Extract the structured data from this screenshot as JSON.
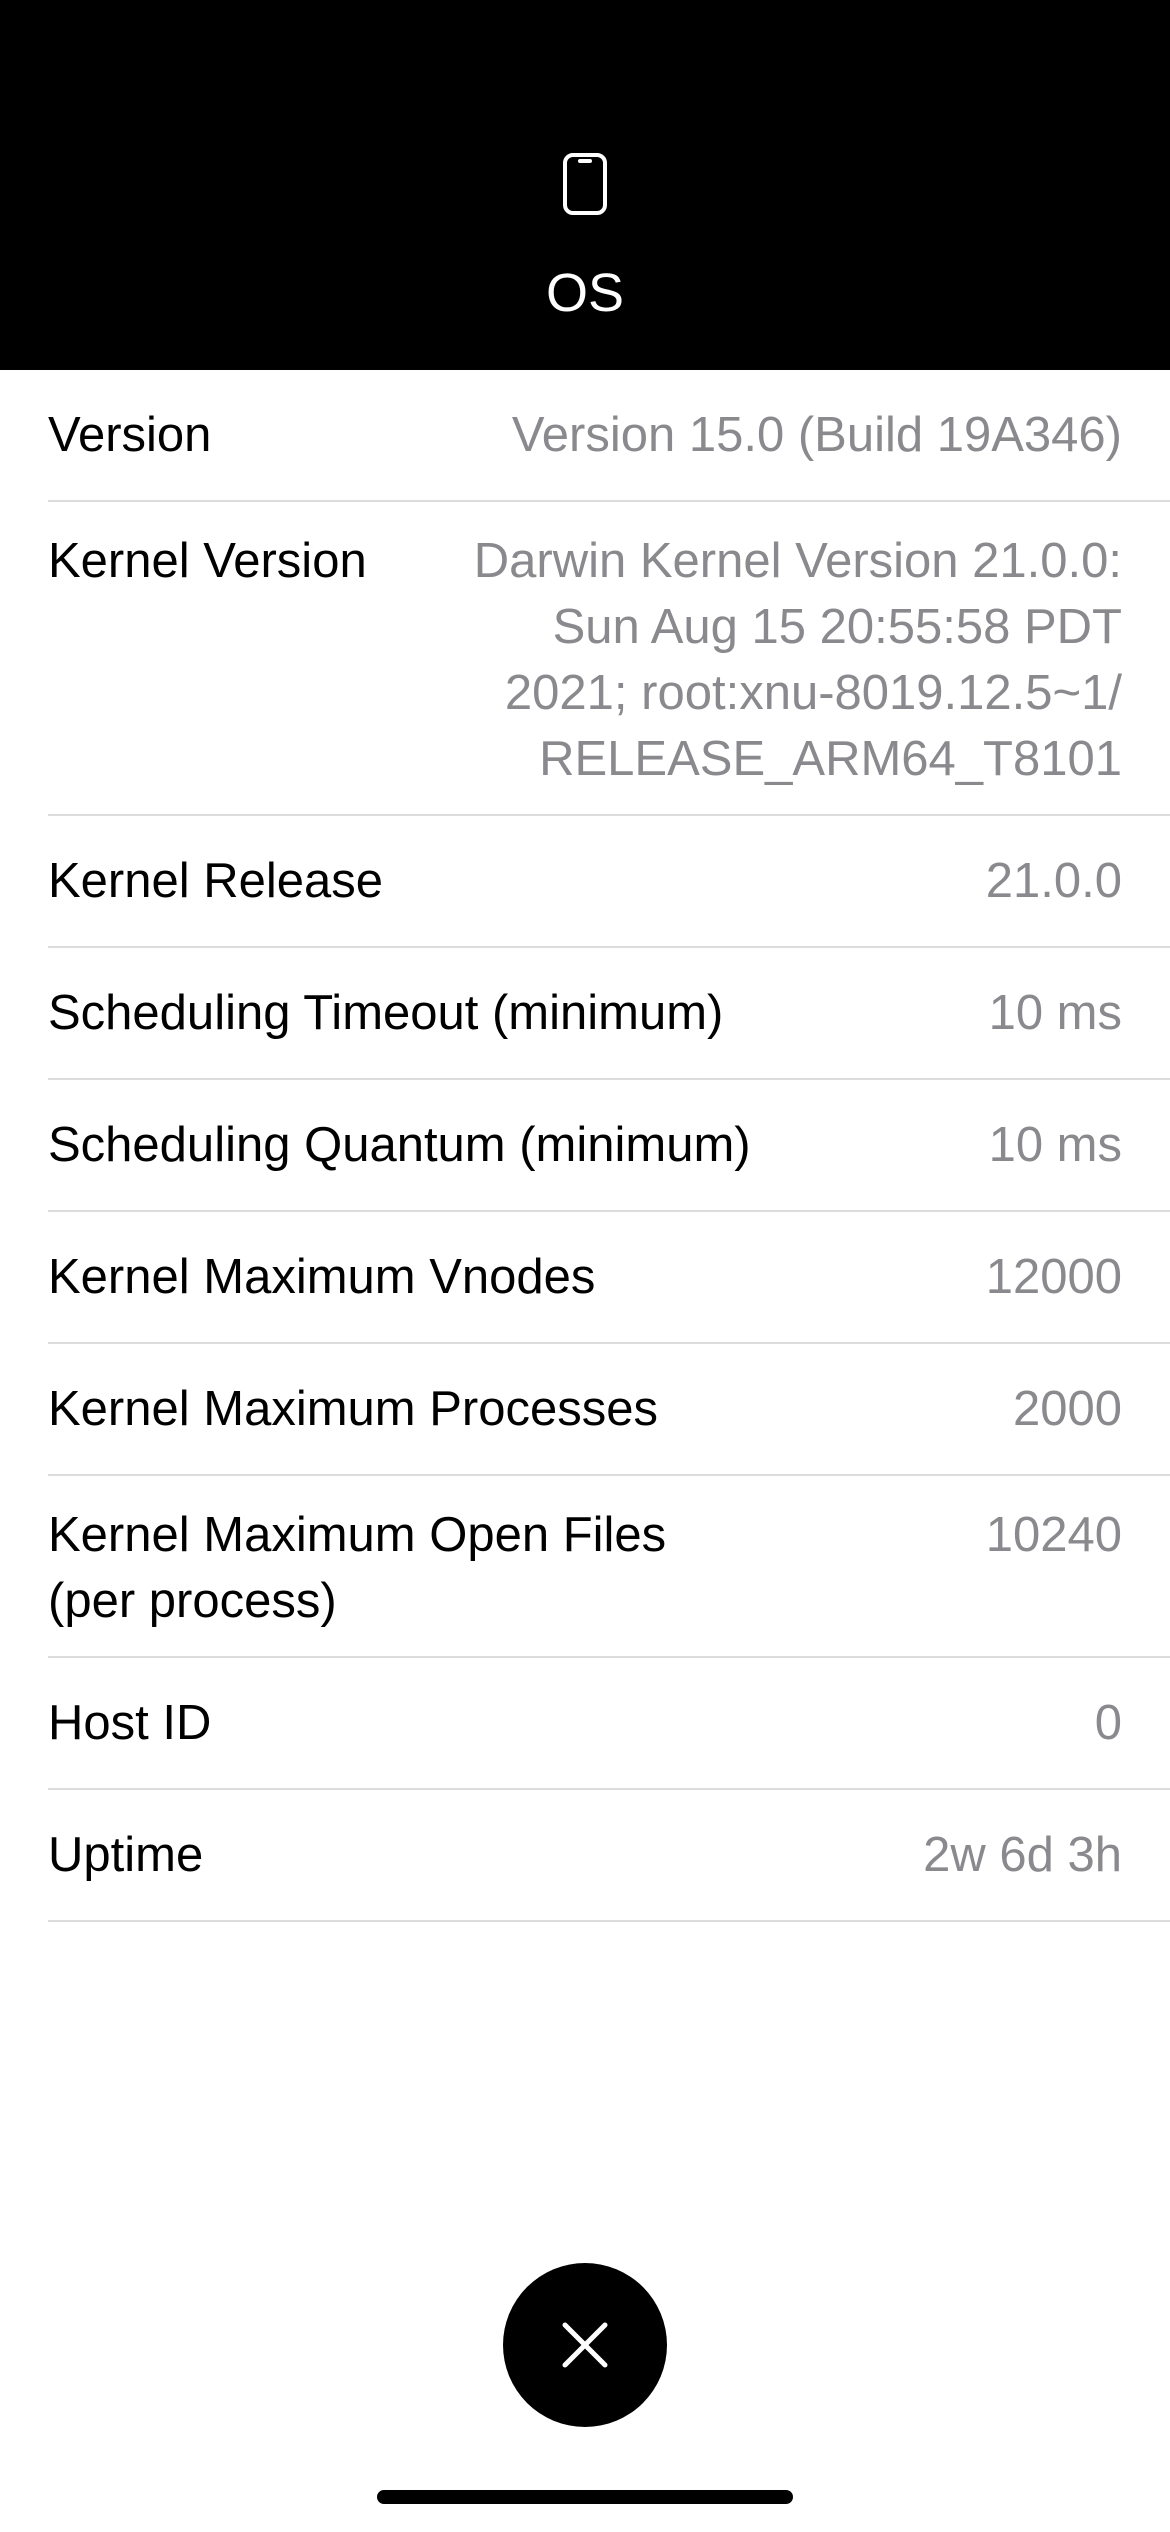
{
  "header": {
    "icon": "phone-icon",
    "title": "OS"
  },
  "rows": [
    {
      "label": "Version",
      "value": "Version 15.0 (Build 19A346)"
    },
    {
      "label": "Kernel Version",
      "value": "Darwin Kernel Version 21.0.0: Sun Aug 15 20:55:58 PDT 2021; root:xnu-8019.12.5~1/ RELEASE_ARM64_T8101"
    },
    {
      "label": "Kernel Release",
      "value": "21.0.0"
    },
    {
      "label": "Scheduling Timeout (minimum)",
      "value": "10 ms"
    },
    {
      "label": "Scheduling Quantum (minimum)",
      "value": "10 ms"
    },
    {
      "label": "Kernel Maximum Vnodes",
      "value": "12000"
    },
    {
      "label": "Kernel Maximum Processes",
      "value": "2000"
    },
    {
      "label": "Kernel Maximum Open Files (per process)",
      "value": "10240"
    },
    {
      "label": "Host ID",
      "value": "0"
    },
    {
      "label": "Uptime",
      "value": "2w 6d 3h"
    }
  ],
  "close_button": {
    "icon": "close-icon"
  },
  "colors": {
    "header_bg": "#000000",
    "value_text": "#8a8a8e",
    "divider": "#dcdcdc"
  }
}
